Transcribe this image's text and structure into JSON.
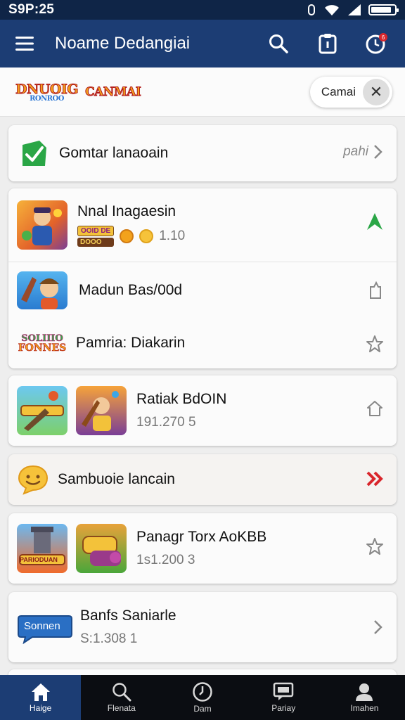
{
  "status_bar": {
    "time": "S9P:25",
    "battery_level": 0.9
  },
  "app_bar": {
    "title": "Noame Dedangiai"
  },
  "logo_strip": {
    "logo_a": {
      "text": "DNUOIG",
      "sub": "RONROO"
    },
    "logo_b": {
      "text": "CANMAI"
    },
    "chip_label": "Camai",
    "chip_close": "✕"
  },
  "colors": {
    "header": "#1c3d74",
    "status_bar": "#0f2547",
    "nav_bg": "#0b0d12",
    "accent_green": "#2aa646",
    "accent_red": "#d9262c"
  },
  "sections": {
    "card1": {
      "icon": "green-check-badge-icon",
      "title": "Gomtar lanaoain",
      "trailing": "pahi"
    },
    "card2": {
      "row1": {
        "title": "Nnal Inagaesin",
        "meta": "1.10",
        "tags": [
          "OOID DE",
          "DOOO"
        ],
        "trailing_icon": "green-arrow-up-icon"
      },
      "row2": {
        "title": "Madun Bas/00d",
        "trailing_icon": "bookmark-icon"
      },
      "row3": {
        "title": "Pamria: Diakarin",
        "logo_text": "SOLIIIO",
        "logo_sub": "FONNES",
        "trailing_icon": "star-icon"
      }
    },
    "card3": {
      "title": "Ratiak BdOIN",
      "meta": "191.270 5",
      "trailing_icon": "star-icon"
    },
    "card4": {
      "title": "Sambuoie lancain",
      "icon": "smiley-chat-icon",
      "trailing_icon": "red-double-chevron-icon"
    },
    "card5": {
      "title": "Panagr Torx AoKBB",
      "meta": "1s1.200 3",
      "thumb_label": "PARIODUAN",
      "trailing_icon": "star-icon"
    },
    "card6": {
      "title": "Banfs Saniarle",
      "meta": "S:1.308 1",
      "badge": "Sonnen",
      "trailing_icon": "chevron-right-icon"
    }
  },
  "bottom_nav": [
    {
      "label": "Haige",
      "icon": "home-icon",
      "active": true
    },
    {
      "label": "Flenata",
      "icon": "search-icon",
      "active": false
    },
    {
      "label": "Dam",
      "icon": "clock-icon",
      "active": false
    },
    {
      "label": "Pariay",
      "icon": "message-icon",
      "active": false
    },
    {
      "label": "Imahen",
      "icon": "person-icon",
      "active": false
    }
  ]
}
